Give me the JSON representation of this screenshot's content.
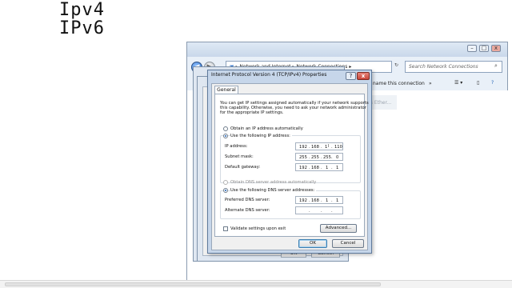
{
  "headings": [
    "Ipv4",
    "IPv6"
  ],
  "explorer": {
    "breadcrumb": [
      "Network and Internet",
      "Network Connections"
    ],
    "breadcrumb_sep": "▸",
    "search_placeholder": "Search Network Connections",
    "cmd_rename": "name this connection",
    "cmd_more": "»",
    "faded_text": "ps Ether..."
  },
  "dialog": {
    "title": "Internet Protocol Version 4 (TCP/IPv4) Properties",
    "help": "?",
    "close": "x",
    "tab": "General",
    "intro": [
      "You can get IP settings assigned automatically if your network supports",
      "this capability. Otherwise, you need to ask your network administrator",
      "for the appropriate IP settings."
    ],
    "ip_auto_label": "Obtain an IP address automatically",
    "ip_manual_label": "Use the following IP address:",
    "ip_mode": "manual",
    "ip_address_label": "IP address:",
    "ip_address": [
      "192",
      "168",
      "1",
      "110"
    ],
    "subnet_label": "Subnet mask:",
    "subnet": [
      "255",
      "255",
      "255",
      "0"
    ],
    "gateway_label": "Default gateway:",
    "gateway": [
      "192",
      "168",
      "1",
      "1"
    ],
    "dns_auto_label": "Obtain DNS server address automatically",
    "dns_manual_label": "Use the following DNS server addresses:",
    "dns_mode": "manual",
    "preferred_dns_label": "Preferred DNS server:",
    "preferred_dns": [
      "192",
      "168",
      "1",
      "1"
    ],
    "alternate_dns_label": "Alternate DNS server:",
    "alternate_dns": [
      "",
      "",
      "",
      ""
    ],
    "validate_label": "Validate settings upon exit",
    "validate_checked": false,
    "advanced_label": "Advanced...",
    "ok_label": "OK",
    "cancel_label": "Cancel"
  },
  "back_dialog": {
    "ok_label": "OK",
    "cancel_label": "Cancel"
  }
}
